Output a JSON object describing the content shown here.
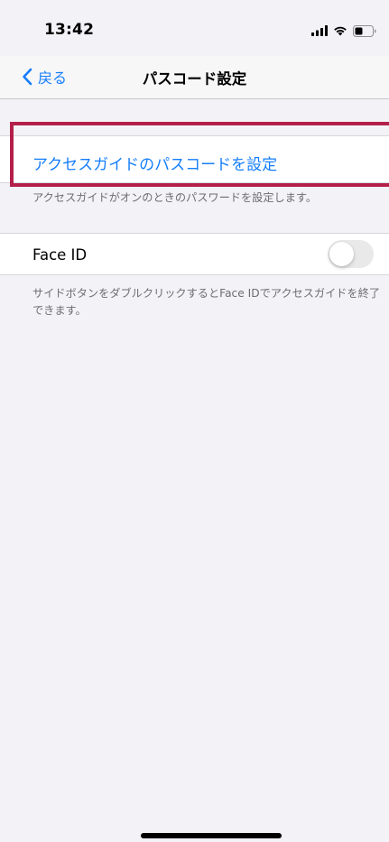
{
  "status_bar": {
    "time": "13:42",
    "icons": [
      "cellular-signal-icon",
      "wifi-icon",
      "battery-icon"
    ]
  },
  "nav": {
    "back_label": "戻る",
    "title": "パスコード設定"
  },
  "passcode_section": {
    "label": "アクセスガイドのパスコードを設定",
    "footnote": "アクセスガイドがオンのときのパスワードを設定します。"
  },
  "face_id_section": {
    "label": "Face ID",
    "toggle_on": false,
    "footnote": "サイドボタンをダブルクリックするとFace IDでアクセスガイドを終了できます。"
  },
  "colors": {
    "accent": "#157efb",
    "highlight": "#b41f4a",
    "background": "#f2f2f7",
    "secondary_text": "#6d6d72"
  }
}
